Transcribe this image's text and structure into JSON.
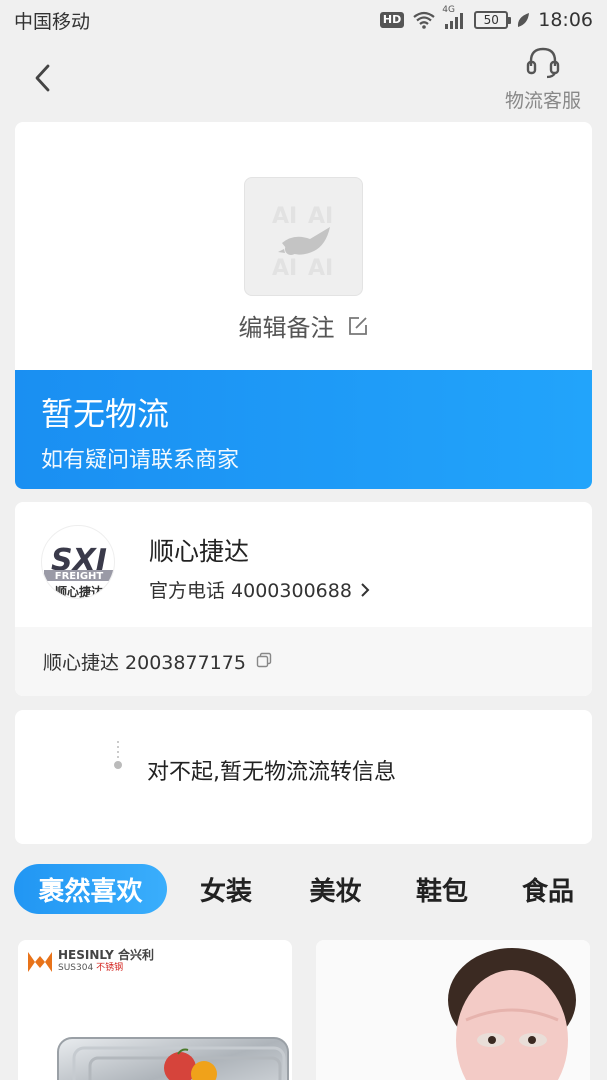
{
  "status_bar": {
    "carrier": "中国移动",
    "hd_label": "HD",
    "network_label": "4G",
    "battery": "50",
    "time": "18:06"
  },
  "nav": {
    "service_label": "物流客服"
  },
  "package": {
    "edit_remark_label": "编辑备注",
    "status_title": "暂无物流",
    "status_subtitle": "如有疑问请联系商家"
  },
  "courier": {
    "logo_text_big": "SXJ",
    "logo_text_mid": "FREIGHT",
    "logo_text_small": "顺心捷达",
    "name": "顺心捷达",
    "phone_label": "官方电话 4000300688",
    "tracking_label": "顺心捷达 2003877175"
  },
  "logistics": {
    "empty_message": "对不起,暂无物流流转信息"
  },
  "categories": {
    "tabs": [
      "裹然喜欢",
      "女装",
      "美妆",
      "鞋包",
      "食品"
    ],
    "active_index": 0
  },
  "products": [
    {
      "brand": "HESINLY",
      "brand_cn": "合兴利",
      "material": "SUS304",
      "material_note": "不锈钢"
    },
    {
      "brand": "",
      "brand_cn": "",
      "material": "",
      "material_note": ""
    }
  ],
  "colors": {
    "accent": "#1a8ff2",
    "background": "#f0f0f0",
    "card": "#ffffff"
  }
}
